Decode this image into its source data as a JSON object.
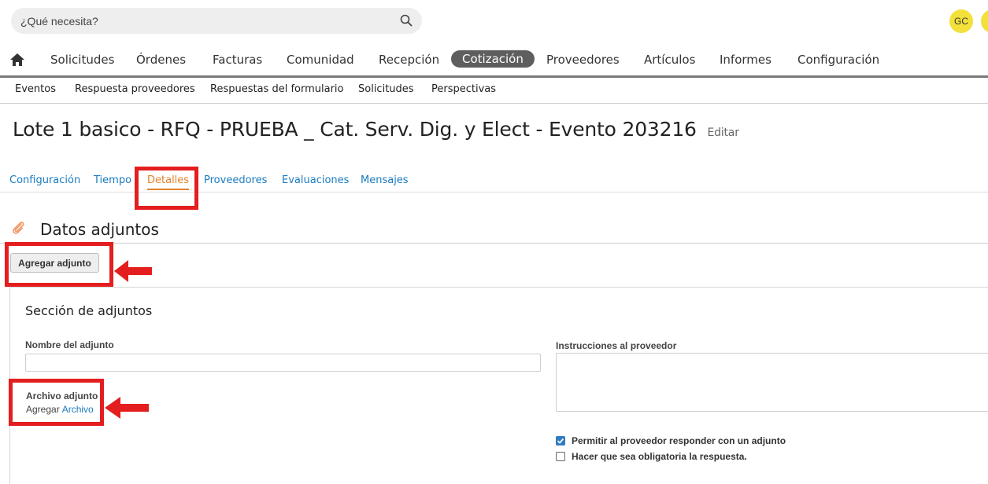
{
  "search": {
    "placeholder": "¿Qué necesita?"
  },
  "user": {
    "initials": "GC"
  },
  "nav": {
    "items": [
      "Solicitudes",
      "Órdenes",
      "Facturas",
      "Comunidad",
      "Recepción",
      "Cotización",
      "Proveedores",
      "Artículos",
      "Informes",
      "Configuración"
    ],
    "active": "Cotización"
  },
  "subnav": {
    "items": [
      "Eventos",
      "Respuesta proveedores",
      "Respuestas del formulario",
      "Solicitudes",
      "Perspectivas"
    ]
  },
  "page": {
    "title": "Lote 1 basico - RFQ - PRUEBA _ Cat. Serv. Dig. y Elect - Evento 203216",
    "edit_label": "Editar"
  },
  "tabs": {
    "items": [
      "Configuración",
      "Tiempo",
      "Detalles",
      "Proveedores",
      "Evaluaciones",
      "Mensajes"
    ],
    "active": "Detalles"
  },
  "attachments": {
    "title": "Datos adjuntos",
    "add_button": "Agregar adjunto",
    "section_title": "Sección de adjuntos",
    "name_label": "Nombre del adjunto",
    "name_value": "",
    "instructions_label": "Instrucciones al proveedor",
    "instructions_value": "",
    "file_label": "Archivo adjunto",
    "file_add_text": "Agregar",
    "file_link": "Archivo",
    "checkbox_allow": {
      "label": "Permitir al proveedor responder con un adjunto",
      "checked": true
    },
    "checkbox_required": {
      "label": "Hacer que sea obligatoria la respuesta.",
      "checked": false
    }
  },
  "colors": {
    "accent": "#e3812b",
    "link": "#1a7bbf",
    "annotation": "#e41e1e",
    "active_nav": "#5e5e5e",
    "avatar": "#f3e03a"
  }
}
